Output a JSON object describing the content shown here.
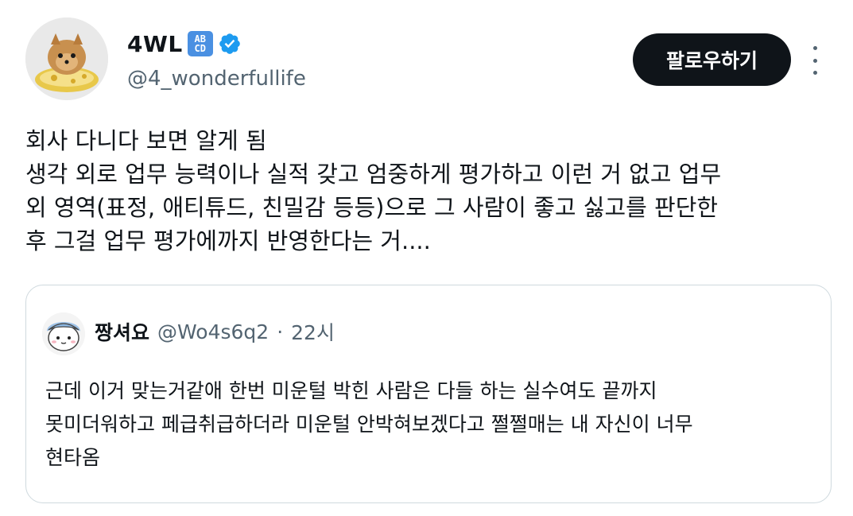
{
  "author": {
    "display_name": "4WL",
    "badge_emoji_top": "AB",
    "badge_emoji_bottom": "CD",
    "handle": "@4_wonderfullife",
    "avatar_icon": "pomeranian-puppy-avatar",
    "verified_color": "#1d9bf0"
  },
  "actions": {
    "follow_label": "팔로우하기",
    "more_icon": "more-vertical-icon"
  },
  "tweet": {
    "lines": [
      "회사 다니다 보면 알게 됨",
      "생각 외로 업무 능력이나 실적 갖고 엄중하게 평가하고 이런 거 없고 업무",
      "외 영역(표정, 애티튜드, 친밀감 등등)으로 그 사람이 좋고 싫고를 판단한",
      "후 그걸 업무 평가에까지 반영한다는 거...."
    ]
  },
  "quote": {
    "display_name": "짱셔요",
    "handle": "@Wo4s6q2",
    "separator": "·",
    "time": "22시",
    "avatar_icon": "cartoon-character-avatar",
    "lines": [
      "근데 이거 맞는거같애 한번 미운털 박힌 사람은 다들 하는 실수여도 끝까지",
      "못미더워하고 페급취급하더라 미운털 안박혀보겠다고 쩔쩔매는 내 자신이 너무",
      "현타옴"
    ]
  },
  "colors": {
    "text": "#0f1419",
    "secondary": "#536471",
    "border": "#cfd9de",
    "button_bg": "#0f1419"
  }
}
